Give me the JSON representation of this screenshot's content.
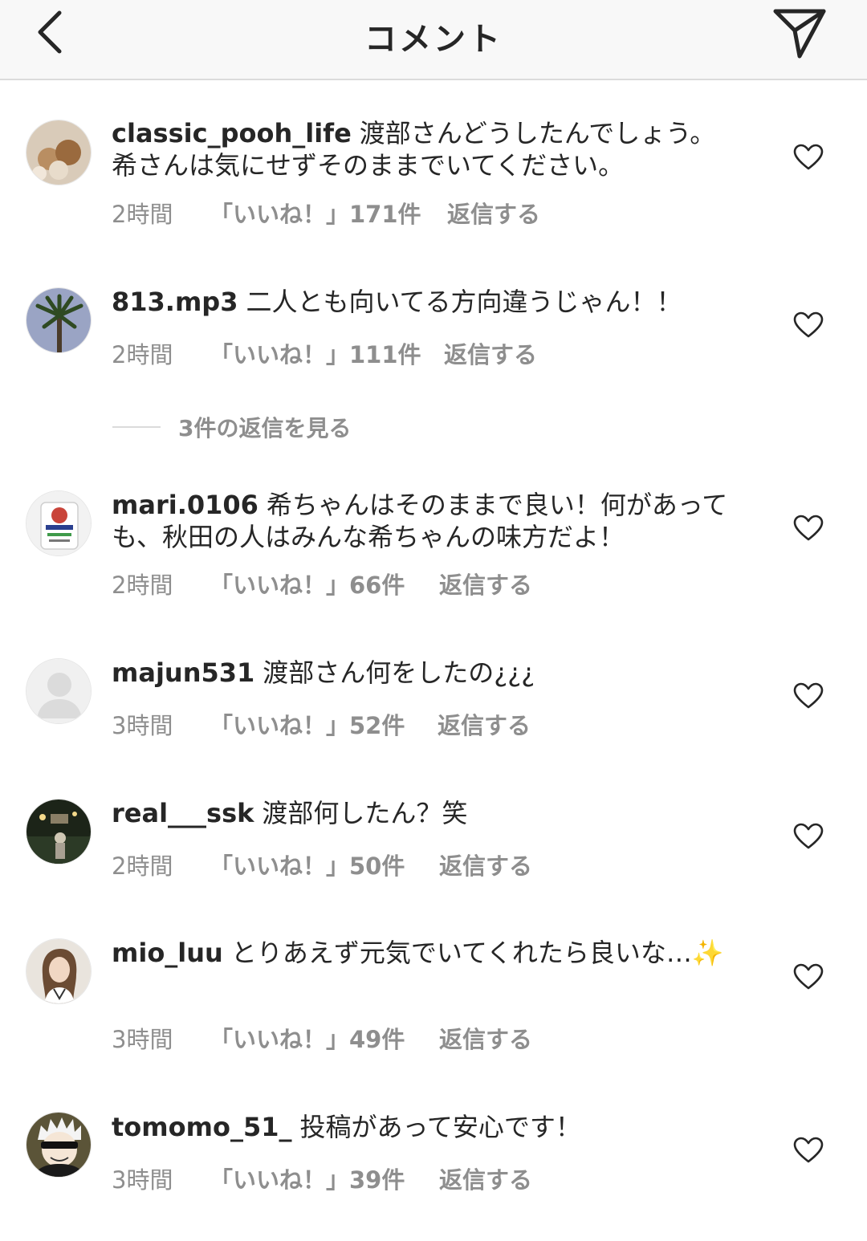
{
  "header": {
    "title": "コメント"
  },
  "comments": [
    {
      "username": "classic_pooh_life",
      "text": "渡部さんどうしたんでしょう。希さんは気にせずそのままでいてください。",
      "time": "2時間",
      "likes": "「いいね！」171件",
      "reply": "返信する"
    },
    {
      "username": "813.mp3",
      "text": "二人とも向いてる方向違うじゃん！！",
      "time": "2時間",
      "likes": "「いいね！」111件",
      "reply": "返信する"
    },
    {
      "username": "mari.0106",
      "text": "希ちゃんはそのままで良い！何があっても、秋田の人はみんな希ちゃんの味方だよ！",
      "time": "2時間",
      "likes": "「いいね！」66件",
      "reply": "返信する"
    },
    {
      "username": "majun531",
      "text": "渡部さん何をしたの¿¿¿",
      "time": "3時間",
      "likes": "「いいね！」52件",
      "reply": "返信する"
    },
    {
      "username": "real___ssk",
      "text": "渡部何したん？笑",
      "time": "2時間",
      "likes": "「いいね！」50件",
      "reply": "返信する"
    },
    {
      "username": "mio_luu",
      "text": "とりあえず元気でいてくれたら良いな…✨",
      "time": "3時間",
      "likes": "「いいね！」49件",
      "reply": "返信する"
    },
    {
      "username": "tomomo_51_",
      "text": "投稿があって安心です！",
      "time": "3時間",
      "likes": "「いいね！」39件",
      "reply": "返信する"
    }
  ],
  "view_replies": {
    "label": "3件の返信を見る"
  },
  "icons": {
    "back": "chevron-left-icon",
    "send": "direct-send-icon",
    "like": "heart-outline-icon"
  },
  "colors": {
    "text": "#262626",
    "secondary": "#8e8e8e",
    "header_bg": "#f8f8f8",
    "divider": "#dbdbdb"
  }
}
